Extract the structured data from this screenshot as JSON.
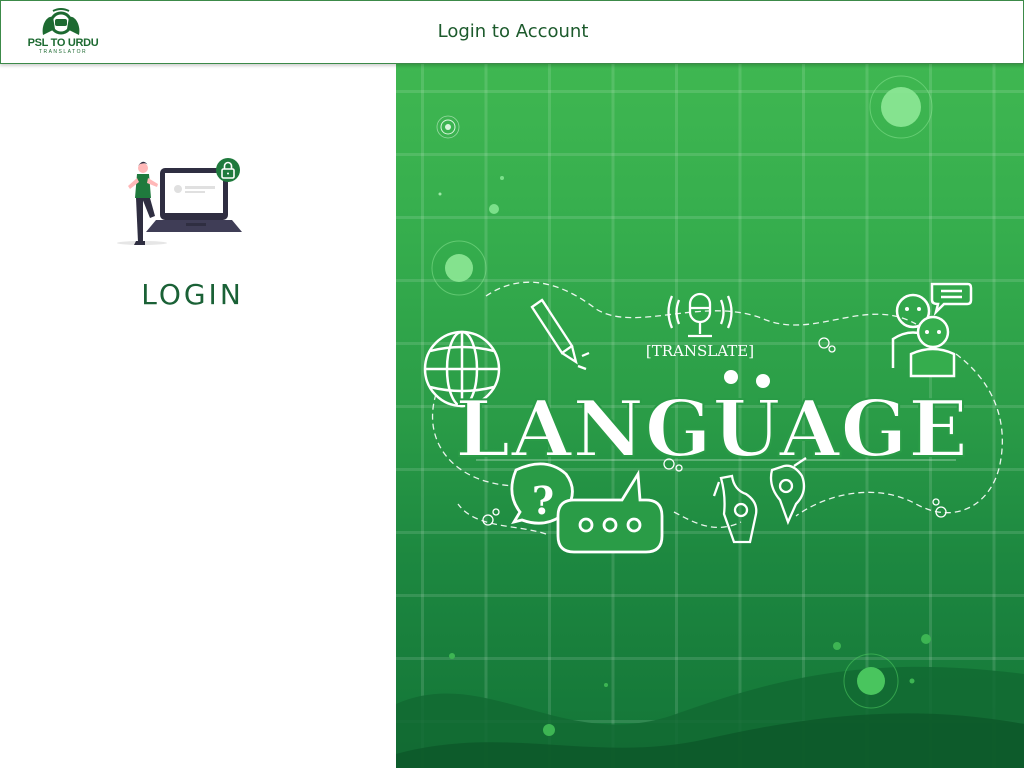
{
  "header": {
    "logo_text": "PSL TO URDU",
    "logo_subtext": "TRANSLATOR",
    "title": "Login to Account"
  },
  "login": {
    "heading": "LOGIN"
  },
  "banner": {
    "tag": "[TRANSLATE]",
    "word": "LANGUAGE",
    "bubble_symbol": "?"
  },
  "colors": {
    "brand_green": "#1c5a2c",
    "panel_green_top": "#3fb751",
    "panel_green_bottom": "#137437"
  }
}
